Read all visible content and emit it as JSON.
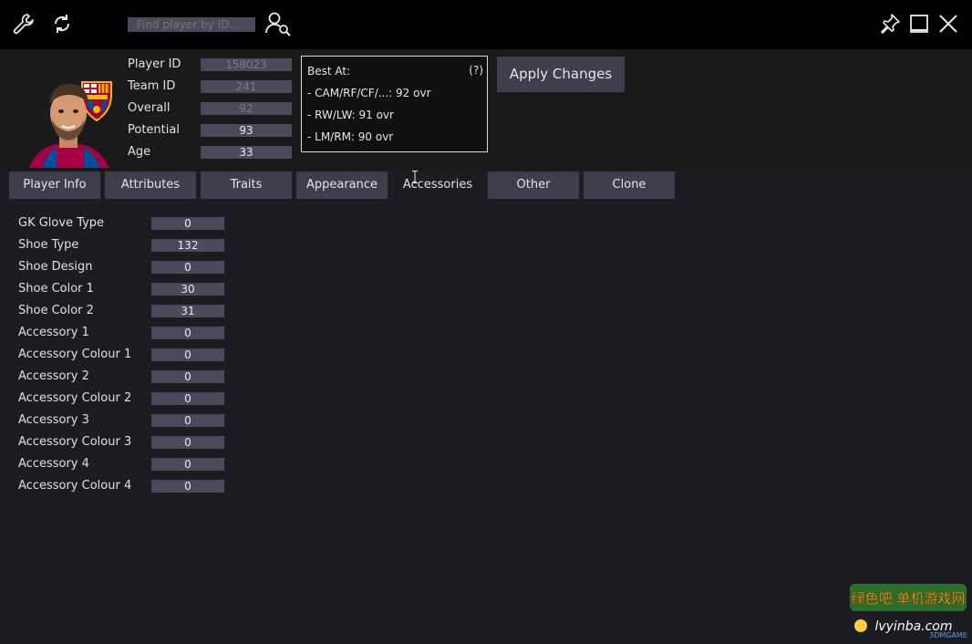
{
  "toolbar": {
    "search_placeholder": "Find player by ID...",
    "icons": [
      "wrench-icon",
      "refresh-icon",
      "player-search-icon",
      "pin-icon",
      "maximize-icon",
      "close-icon"
    ]
  },
  "player": {
    "labels": {
      "player_id": "Player ID",
      "team_id": "Team ID",
      "overall": "Overall",
      "potential": "Potential",
      "age": "Age"
    },
    "values": {
      "player_id": "158023",
      "team_id": "241",
      "overall": "92",
      "potential": "93",
      "age": "33"
    }
  },
  "best_at": {
    "title": "Best At:",
    "help": "(?)",
    "lines": [
      "- CAM/RF/CF/...: 92 ovr",
      "- RW/LW: 91 ovr",
      "- LM/RM: 90 ovr"
    ]
  },
  "apply_label": "Apply Changes",
  "tabs": [
    "Player Info",
    "Attributes",
    "Traits",
    "Appearance",
    "Accessories",
    "Other",
    "Clone"
  ],
  "active_tab": "Accessories",
  "accessories": [
    {
      "label": "GK Glove Type",
      "value": "0"
    },
    {
      "label": "Shoe Type",
      "value": "132"
    },
    {
      "label": "Shoe Design",
      "value": "0"
    },
    {
      "label": "Shoe Color 1",
      "value": "30"
    },
    {
      "label": "Shoe Color 2",
      "value": "31"
    },
    {
      "label": "Accessory 1",
      "value": "0"
    },
    {
      "label": "Accessory Colour 1",
      "value": "0"
    },
    {
      "label": "Accessory 2",
      "value": "0"
    },
    {
      "label": "Accessory Colour 2",
      "value": "0"
    },
    {
      "label": "Accessory 3",
      "value": "0"
    },
    {
      "label": "Accessory Colour 3",
      "value": "0"
    },
    {
      "label": "Accessory 4",
      "value": "0"
    },
    {
      "label": "Accessory Colour 4",
      "value": "0"
    }
  ],
  "watermark": {
    "line1": "绿色吧 单机游戏网",
    "line2": "lvyinba.com",
    "brand": "3DMGAME"
  },
  "colors": {
    "background": "#1c1c22",
    "topbar": "#000000",
    "header": "#1a1a1a",
    "field": "#4a4a5a",
    "tab": "#3e3e4c"
  }
}
